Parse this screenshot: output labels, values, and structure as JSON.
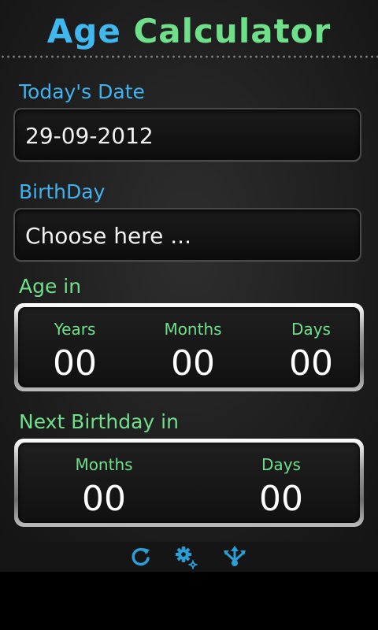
{
  "app": {
    "title_part1": "Age",
    "title_part2": "Calculator"
  },
  "today": {
    "label": "Today's Date",
    "value": "29-09-2012"
  },
  "birthday": {
    "label": "BirthDay",
    "value": "Choose here ..."
  },
  "age": {
    "label": "Age in",
    "columns": [
      {
        "caption": "Years",
        "value": "00"
      },
      {
        "caption": "Months",
        "value": "00"
      },
      {
        "caption": "Days",
        "value": "00"
      }
    ]
  },
  "next_birthday": {
    "label": "Next Birthday in",
    "columns": [
      {
        "caption": "Months",
        "value": "00"
      },
      {
        "caption": "Days",
        "value": "00"
      }
    ]
  },
  "toolbar": {
    "icons": [
      "refresh-icon",
      "settings-icon",
      "share-icon"
    ]
  },
  "colors": {
    "blue_accent": "#3fb8f0",
    "green_accent": "#6fe08a",
    "icon_blue": "#2a9fd6"
  }
}
